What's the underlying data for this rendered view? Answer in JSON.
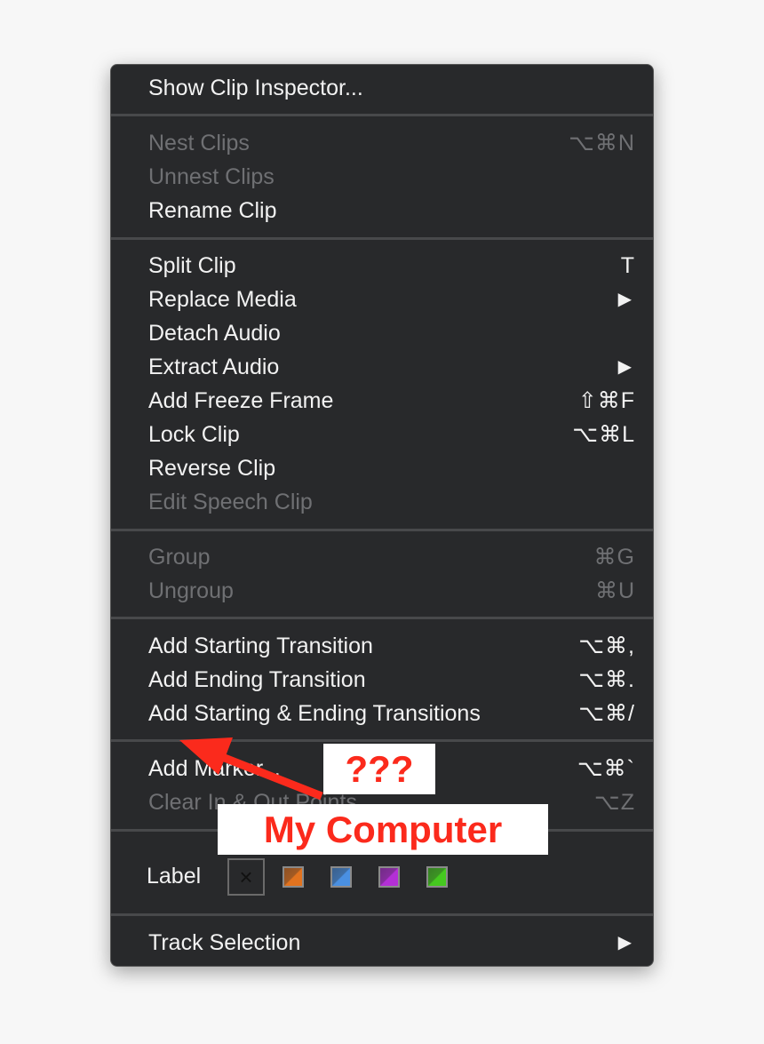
{
  "menu": {
    "sections": [
      [
        {
          "label": "Show Clip Inspector...",
          "shortcut": "",
          "enabled": true
        }
      ],
      [
        {
          "label": "Nest Clips",
          "shortcut": "⌥⌘N",
          "enabled": false
        },
        {
          "label": "Unnest Clips",
          "shortcut": "",
          "enabled": false
        },
        {
          "label": "Rename Clip",
          "shortcut": "",
          "enabled": true
        }
      ],
      [
        {
          "label": "Split Clip",
          "shortcut": "T",
          "enabled": true
        },
        {
          "label": "Replace Media",
          "shortcut": "",
          "submenu": true,
          "enabled": true
        },
        {
          "label": "Detach Audio",
          "shortcut": "",
          "enabled": true
        },
        {
          "label": "Extract Audio",
          "shortcut": "",
          "submenu": true,
          "enabled": true
        },
        {
          "label": "Add Freeze Frame",
          "shortcut": "⇧⌘F",
          "enabled": true
        },
        {
          "label": "Lock Clip",
          "shortcut": "⌥⌘L",
          "enabled": true
        },
        {
          "label": "Reverse Clip",
          "shortcut": "",
          "enabled": true
        },
        {
          "label": "Edit Speech Clip",
          "shortcut": "",
          "enabled": false
        }
      ],
      [
        {
          "label": "Group",
          "shortcut": "⌘G",
          "enabled": false
        },
        {
          "label": "Ungroup",
          "shortcut": "⌘U",
          "enabled": false
        }
      ],
      [
        {
          "label": "Add Starting Transition",
          "shortcut": "⌥⌘,",
          "enabled": true
        },
        {
          "label": "Add Ending Transition",
          "shortcut": "⌥⌘.",
          "enabled": true
        },
        {
          "label": "Add Starting & Ending Transitions",
          "shortcut": "⌥⌘/",
          "enabled": true
        }
      ],
      [
        {
          "label": "Add Marker...",
          "shortcut": "⌥⌘`",
          "enabled": true
        },
        {
          "label": "Clear In & Out Points",
          "shortcut": "⌥Z",
          "enabled": false
        }
      ]
    ],
    "label_row": {
      "label": "Label",
      "none_symbol": "×",
      "colors": [
        "#e2731f",
        "#4a90e2",
        "#b32fd6",
        "#45c91f"
      ]
    },
    "last": {
      "label": "Track Selection",
      "submenu": true
    },
    "submenu_arrow": "▶"
  },
  "annotations": {
    "question": "???",
    "caption": "My Computer",
    "color": "#fb2a1c"
  }
}
